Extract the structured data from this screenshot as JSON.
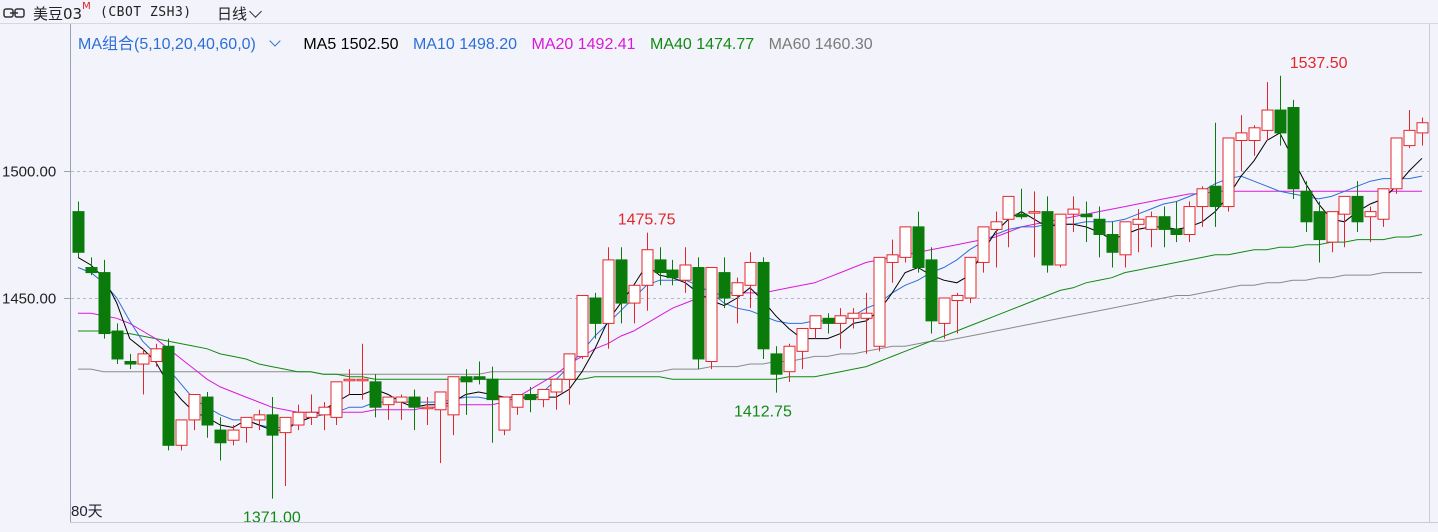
{
  "header": {
    "title": "美豆03",
    "title_mark": "M",
    "code": "(CBOT ZSH3)",
    "period": "日线"
  },
  "ma_legend": {
    "combo_label": "MA组合(5,10,20,40,60,0)",
    "items": [
      {
        "label": "MA5 1502.50",
        "color": "#000000"
      },
      {
        "label": "MA10 1498.20",
        "color": "#2d6fd6"
      },
      {
        "label": "MA20 1492.41",
        "color": "#d919d9"
      },
      {
        "label": "MA40 1474.77",
        "color": "#138a13"
      },
      {
        "label": "MA60 1460.30",
        "color": "#7a7a7a"
      }
    ]
  },
  "days_label": "80天",
  "colors": {
    "up": "#e0282c",
    "down": "#0a7a0a",
    "ma5": "#000000",
    "ma10": "#2d6fd6",
    "ma20": "#d919d9",
    "ma40": "#138a13",
    "ma60": "#8a8a8a"
  },
  "chart_data": {
    "type": "candlestick",
    "y_ticks": [
      "1500.00",
      "1450.00"
    ],
    "ylim": [
      1362,
      1552
    ],
    "annotations": [
      {
        "index": 15,
        "value": 1371.0,
        "label": "1371.00",
        "position": "below",
        "color": "#138a13"
      },
      {
        "index": 44,
        "value": 1475.75,
        "label": "1475.75",
        "position": "above",
        "color": "#e0282c"
      },
      {
        "index": 53,
        "value": 1412.75,
        "label": "1412.75",
        "position": "below",
        "color": "#138a13"
      },
      {
        "index": 96,
        "value": 1537.5,
        "label": "1537.50",
        "position": "above",
        "color": "#e0282c"
      }
    ],
    "candles": [
      [
        1484,
        1488,
        1468,
        1466
      ],
      [
        1462,
        1466,
        1460,
        1459
      ],
      [
        1460,
        1465,
        1436,
        1434
      ],
      [
        1437,
        1440,
        1426,
        1424
      ],
      [
        1425,
        1428,
        1424,
        1422
      ],
      [
        1424,
        1430,
        1428,
        1412
      ],
      [
        1425,
        1432,
        1430,
        1423
      ],
      [
        1431,
        1434,
        1392,
        1390
      ],
      [
        1392,
        1397,
        1402,
        1390
      ],
      [
        1402,
        1405,
        1412,
        1398
      ],
      [
        1411,
        1413,
        1400,
        1395
      ],
      [
        1398,
        1403,
        1393,
        1386
      ],
      [
        1394,
        1400,
        1398,
        1392
      ],
      [
        1399,
        1402,
        1403,
        1393
      ],
      [
        1402,
        1406,
        1404,
        1398
      ],
      [
        1404,
        1411,
        1396,
        1371
      ],
      [
        1397,
        1400,
        1403,
        1376
      ],
      [
        1400,
        1408,
        1405,
        1398
      ],
      [
        1403,
        1412,
        1405,
        1400
      ],
      [
        1404,
        1409,
        1407,
        1398
      ],
      [
        1403,
        1405,
        1417,
        1400
      ],
      [
        1418,
        1422,
        1418,
        1412
      ],
      [
        1418,
        1432,
        1418,
        1410
      ],
      [
        1417,
        1420,
        1407,
        1403
      ],
      [
        1408,
        1410,
        1411,
        1402
      ],
      [
        1409,
        1412,
        1411,
        1402
      ],
      [
        1411,
        1414,
        1407,
        1398
      ],
      [
        1407,
        1411,
        1407,
        1400
      ],
      [
        1406,
        1409,
        1413,
        1385
      ],
      [
        1404,
        1408,
        1419,
        1396
      ],
      [
        1419,
        1422,
        1417,
        1404
      ],
      [
        1419,
        1425,
        1418,
        1416
      ],
      [
        1418,
        1423,
        1410,
        1393
      ],
      [
        1398,
        1401,
        1411,
        1396
      ],
      [
        1407,
        1410,
        1412,
        1404
      ],
      [
        1412,
        1415,
        1410,
        1405
      ],
      [
        1410,
        1414,
        1414,
        1407
      ],
      [
        1413,
        1416,
        1418,
        1406
      ],
      [
        1418,
        1427,
        1428,
        1408
      ],
      [
        1427,
        1429,
        1451,
        1426
      ],
      [
        1450,
        1452,
        1440,
        1434
      ],
      [
        1440,
        1470,
        1465,
        1430
      ],
      [
        1465,
        1470,
        1448,
        1440
      ],
      [
        1448,
        1452,
        1455,
        1440
      ],
      [
        1455,
        1475.75,
        1469,
        1445
      ],
      [
        1465,
        1470,
        1460,
        1455
      ],
      [
        1461,
        1465,
        1458,
        1455
      ],
      [
        1457,
        1470,
        1463,
        1452
      ],
      [
        1462,
        1466,
        1426,
        1422
      ],
      [
        1425,
        1432,
        1462,
        1422
      ],
      [
        1460,
        1466,
        1450,
        1446
      ],
      [
        1451,
        1458,
        1456,
        1440
      ],
      [
        1455,
        1468,
        1464,
        1446
      ],
      [
        1464,
        1466,
        1430,
        1426
      ],
      [
        1428,
        1431,
        1420,
        1412.75
      ],
      [
        1421,
        1432,
        1431,
        1417
      ],
      [
        1429,
        1436,
        1438,
        1422
      ],
      [
        1438,
        1441,
        1443,
        1434
      ],
      [
        1442,
        1444,
        1440,
        1436
      ],
      [
        1440,
        1446,
        1443,
        1430
      ],
      [
        1442,
        1446,
        1444,
        1438
      ],
      [
        1442,
        1452,
        1444,
        1428
      ],
      [
        1431,
        1442,
        1466,
        1429
      ],
      [
        1464,
        1473,
        1467,
        1456
      ],
      [
        1466,
        1477,
        1478,
        1464
      ],
      [
        1478,
        1484,
        1462,
        1460
      ],
      [
        1465,
        1470,
        1441,
        1436
      ],
      [
        1440,
        1445,
        1450,
        1434
      ],
      [
        1449,
        1452,
        1451,
        1436
      ],
      [
        1450,
        1462,
        1466,
        1448
      ],
      [
        1464,
        1478,
        1478,
        1460
      ],
      [
        1477,
        1484,
        1480,
        1462
      ],
      [
        1481,
        1490,
        1490,
        1470
      ],
      [
        1483,
        1493,
        1482,
        1481
      ],
      [
        1484,
        1492,
        1484,
        1466
      ],
      [
        1484,
        1490,
        1463,
        1460
      ],
      [
        1463,
        1476,
        1483,
        1462
      ],
      [
        1483,
        1490,
        1485,
        1476
      ],
      [
        1483,
        1488,
        1482,
        1472
      ],
      [
        1481,
        1486,
        1475,
        1466
      ],
      [
        1475,
        1480,
        1468,
        1462
      ],
      [
        1467,
        1473,
        1480,
        1462
      ],
      [
        1479,
        1485,
        1481,
        1468
      ],
      [
        1477,
        1484,
        1482,
        1470
      ],
      [
        1482,
        1486,
        1477,
        1470
      ],
      [
        1477,
        1488,
        1475,
        1472
      ],
      [
        1475,
        1488,
        1486,
        1472
      ],
      [
        1486,
        1494,
        1493,
        1478
      ],
      [
        1494,
        1519,
        1486,
        1478
      ],
      [
        1486,
        1492,
        1513,
        1484
      ],
      [
        1512,
        1522,
        1515,
        1500
      ],
      [
        1512,
        1518,
        1517,
        1506
      ],
      [
        1516,
        1535,
        1524,
        1512
      ],
      [
        1524,
        1537.5,
        1515,
        1510
      ],
      [
        1525,
        1528,
        1493,
        1489
      ],
      [
        1492,
        1496,
        1480,
        1476
      ],
      [
        1484,
        1488,
        1473,
        1464
      ],
      [
        1472,
        1480,
        1484,
        1468
      ],
      [
        1483,
        1490,
        1490,
        1470
      ],
      [
        1490,
        1496,
        1480,
        1476
      ],
      [
        1482,
        1486,
        1484,
        1472
      ],
      [
        1481,
        1487,
        1493,
        1478
      ],
      [
        1493,
        1498,
        1513,
        1491
      ],
      [
        1510,
        1524,
        1516,
        1509
      ],
      [
        1515,
        1521,
        1519,
        1510
      ]
    ],
    "ma5": [
      1466,
      1463,
      1458,
      1448,
      1434,
      1430,
      1425,
      1416,
      1410,
      1405,
      1403,
      1400,
      1399,
      1402,
      1400,
      1398,
      1398,
      1401,
      1403,
      1406,
      1409,
      1412,
      1412,
      1414,
      1412,
      1409,
      1407,
      1408,
      1408,
      1409,
      1412,
      1413,
      1412,
      1411,
      1411,
      1411,
      1411,
      1411,
      1414,
      1421,
      1430,
      1441,
      1448,
      1455,
      1463,
      1459,
      1458,
      1456,
      1452,
      1449,
      1447,
      1450,
      1454,
      1449,
      1443,
      1438,
      1434,
      1434,
      1434,
      1436,
      1440,
      1441,
      1445,
      1452,
      1460,
      1462,
      1459,
      1457,
      1456,
      1459,
      1468,
      1476,
      1481,
      1484,
      1481,
      1478,
      1479,
      1479,
      1478,
      1476,
      1473,
      1475,
      1477,
      1478,
      1478,
      1477,
      1478,
      1480,
      1484,
      1490,
      1498,
      1504,
      1512,
      1515,
      1505,
      1495,
      1487,
      1481,
      1480,
      1484,
      1487,
      1489,
      1494,
      1500,
      1505
    ],
    "ma10": [
      1462,
      1460,
      1456,
      1450,
      1441,
      1433,
      1428,
      1422,
      1416,
      1410,
      1407,
      1404,
      1402,
      1402,
      1400,
      1399,
      1399,
      1401,
      1403,
      1404,
      1405,
      1407,
      1407,
      1409,
      1409,
      1409,
      1409,
      1409,
      1409,
      1410,
      1411,
      1411,
      1410,
      1410,
      1410,
      1411,
      1413,
      1418,
      1423,
      1429,
      1435,
      1440,
      1445,
      1450,
      1455,
      1457,
      1457,
      1457,
      1455,
      1452,
      1448,
      1446,
      1445,
      1443,
      1441,
      1440,
      1440,
      1441,
      1441,
      1441,
      1443,
      1446,
      1448,
      1452,
      1455,
      1457,
      1460,
      1462,
      1465,
      1469,
      1472,
      1475,
      1477,
      1478,
      1478,
      1479,
      1479,
      1479,
      1480,
      1480,
      1480,
      1481,
      1483,
      1485,
      1487,
      1488,
      1490,
      1492,
      1495,
      1497,
      1498,
      1496,
      1494,
      1492,
      1491,
      1490,
      1489,
      1490,
      1492,
      1494,
      1496,
      1497,
      1497,
      1497,
      1498
    ],
    "ma20": [
      1444,
      1444,
      1443,
      1442,
      1440,
      1437,
      1434,
      1430,
      1426,
      1422,
      1418,
      1415,
      1413,
      1411,
      1409,
      1407,
      1406,
      1405,
      1405,
      1405,
      1405,
      1405,
      1405,
      1406,
      1406,
      1406,
      1406,
      1407,
      1407,
      1408,
      1408,
      1408,
      1408,
      1409,
      1411,
      1414,
      1417,
      1420,
      1424,
      1427,
      1430,
      1432,
      1435,
      1437,
      1440,
      1443,
      1446,
      1448,
      1450,
      1451,
      1452,
      1452,
      1452,
      1452,
      1453,
      1454,
      1455,
      1456,
      1458,
      1460,
      1462,
      1464,
      1465,
      1466,
      1467,
      1468,
      1469,
      1470,
      1471,
      1472,
      1473,
      1474,
      1476,
      1478,
      1479,
      1480,
      1481,
      1482,
      1483,
      1484,
      1485,
      1486,
      1487,
      1488,
      1489,
      1490,
      1491,
      1491,
      1492,
      1492,
      1492,
      1492,
      1492,
      1492,
      1492,
      1492,
      1492,
      1492,
      1492,
      1492,
      1492,
      1492,
      1492,
      1492,
      1492
    ],
    "ma40": [
      1437,
      1437,
      1437,
      1436,
      1436,
      1435,
      1434,
      1433,
      1432,
      1431,
      1430,
      1428,
      1427,
      1426,
      1424,
      1423,
      1422,
      1421,
      1421,
      1420,
      1420,
      1419,
      1419,
      1418,
      1418,
      1418,
      1418,
      1418,
      1418,
      1418,
      1418,
      1418,
      1418,
      1418,
      1418,
      1418,
      1418,
      1418,
      1418,
      1418,
      1419,
      1419,
      1419,
      1419,
      1419,
      1419,
      1418,
      1418,
      1418,
      1418,
      1418,
      1418,
      1418,
      1418,
      1418,
      1419,
      1419,
      1419,
      1420,
      1421,
      1422,
      1423,
      1425,
      1427,
      1429,
      1431,
      1433,
      1435,
      1437,
      1439,
      1441,
      1443,
      1445,
      1447,
      1449,
      1451,
      1453,
      1454,
      1456,
      1457,
      1458,
      1460,
      1461,
      1462,
      1463,
      1464,
      1465,
      1466,
      1467,
      1467,
      1468,
      1469,
      1469,
      1470,
      1470,
      1471,
      1471,
      1472,
      1472,
      1473,
      1473,
      1473,
      1474,
      1474,
      1475
    ],
    "ma60": [
      1422,
      1422,
      1421,
      1421,
      1421,
      1421,
      1421,
      1421,
      1421,
      1421,
      1421,
      1421,
      1421,
      1421,
      1421,
      1421,
      1421,
      1421,
      1421,
      1420,
      1420,
      1420,
      1420,
      1420,
      1420,
      1420,
      1420,
      1420,
      1420,
      1420,
      1420,
      1420,
      1421,
      1421,
      1421,
      1421,
      1421,
      1421,
      1421,
      1421,
      1421,
      1421,
      1421,
      1421,
      1421,
      1421,
      1422,
      1422,
      1422,
      1423,
      1423,
      1423,
      1424,
      1424,
      1425,
      1425,
      1426,
      1427,
      1427,
      1428,
      1428,
      1429,
      1430,
      1431,
      1431,
      1432,
      1433,
      1433,
      1434,
      1435,
      1436,
      1437,
      1438,
      1439,
      1440,
      1441,
      1442,
      1443,
      1444,
      1445,
      1446,
      1447,
      1448,
      1449,
      1450,
      1451,
      1451,
      1452,
      1453,
      1454,
      1455,
      1455,
      1456,
      1456,
      1457,
      1457,
      1458,
      1458,
      1459,
      1459,
      1459,
      1460,
      1460,
      1460,
      1460
    ]
  }
}
